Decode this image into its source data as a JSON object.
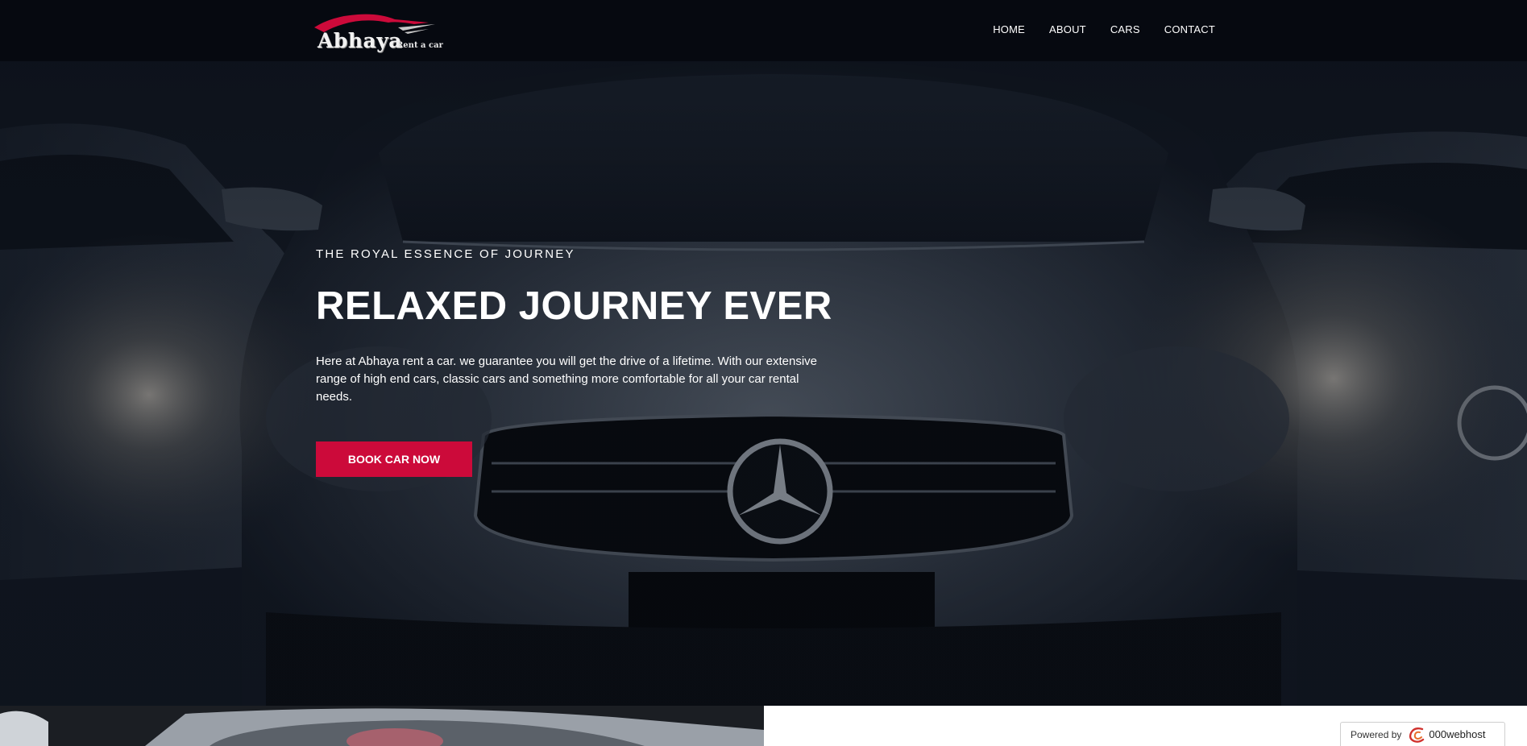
{
  "brand": {
    "name": "Abhaya",
    "tagline": "Rent a car",
    "accent": "#cc0a3a"
  },
  "nav": {
    "items": [
      {
        "label": "HOME"
      },
      {
        "label": "ABOUT"
      },
      {
        "label": "CARS"
      },
      {
        "label": "CONTACT"
      }
    ]
  },
  "hero": {
    "eyebrow": "THE ROYAL ESSENCE OF JOURNEY",
    "headline": "RELAXED JOURNEY EVER",
    "description": "Here at Abhaya rent a car. we guarantee you will get the drive of a lifetime. With our extensive range of high end cars, classic cars and something more comfortable for all your car rental needs.",
    "cta_label": "BOOK CAR NOW",
    "background_icon": "car-photo"
  },
  "badge": {
    "powered_label": "Powered by",
    "host_name": "000webhost",
    "icon": "000webhost-logo-icon"
  }
}
